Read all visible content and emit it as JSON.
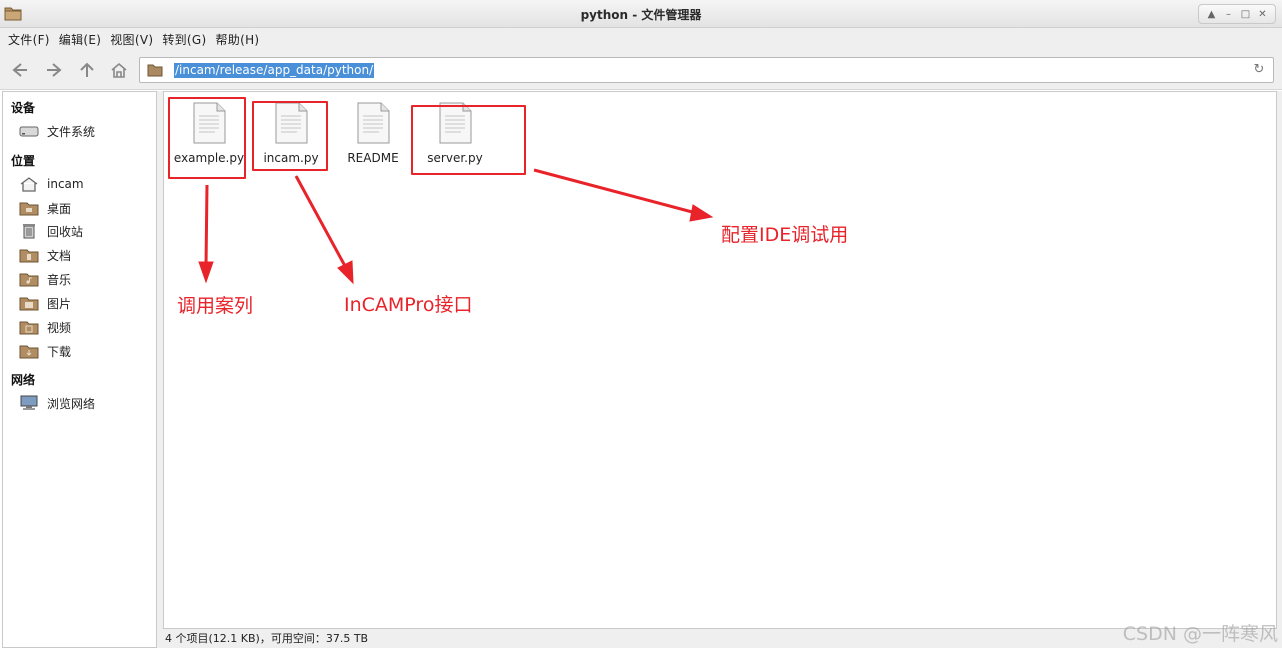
{
  "window": {
    "title": "python - 文件管理器",
    "controls": [
      "up-icon",
      "minimize-icon",
      "maximize-icon",
      "close-icon"
    ]
  },
  "menubar": {
    "items": [
      "文件(F)",
      "编辑(E)",
      "视图(V)",
      "转到(G)",
      "帮助(H)"
    ]
  },
  "toolbar": {
    "icons": [
      "back-icon",
      "forward-icon",
      "up-icon",
      "home-icon"
    ],
    "location_path": "/incam/release/app_data/python/"
  },
  "sidebar": {
    "sections": [
      {
        "heading": "设备",
        "items": [
          {
            "label": "文件系统",
            "icon": "drive-icon"
          }
        ]
      },
      {
        "heading": "位置",
        "items": [
          {
            "label": "incam",
            "icon": "home-icon"
          },
          {
            "label": "桌面",
            "icon": "desktop-folder-icon"
          },
          {
            "label": "回收站",
            "icon": "trash-icon"
          },
          {
            "label": "文档",
            "icon": "documents-folder-icon"
          },
          {
            "label": "音乐",
            "icon": "music-folder-icon"
          },
          {
            "label": "图片",
            "icon": "pictures-folder-icon"
          },
          {
            "label": "视频",
            "icon": "videos-folder-icon"
          },
          {
            "label": "下载",
            "icon": "downloads-folder-icon"
          }
        ]
      },
      {
        "heading": "网络",
        "items": [
          {
            "label": "浏览网络",
            "icon": "network-icon"
          }
        ]
      }
    ]
  },
  "files": [
    {
      "name": "example.py",
      "icon": "text-file-icon"
    },
    {
      "name": "incam.py",
      "icon": "text-file-icon"
    },
    {
      "name": "README",
      "icon": "text-file-icon"
    },
    {
      "name": "server.py",
      "icon": "text-file-icon"
    }
  ],
  "annotations": {
    "color": "#e8232a",
    "example_note": "调用案列",
    "incam_note": "InCAMPro接口",
    "server_note": "配置IDE调试用"
  },
  "status": {
    "text": "4 个项目(12.1 KB)，可用空间：37.5 TB"
  },
  "watermark": "CSDN @一阵寒风",
  "colors": {
    "selection": "#4a90d9",
    "chrome": "#efefef"
  }
}
